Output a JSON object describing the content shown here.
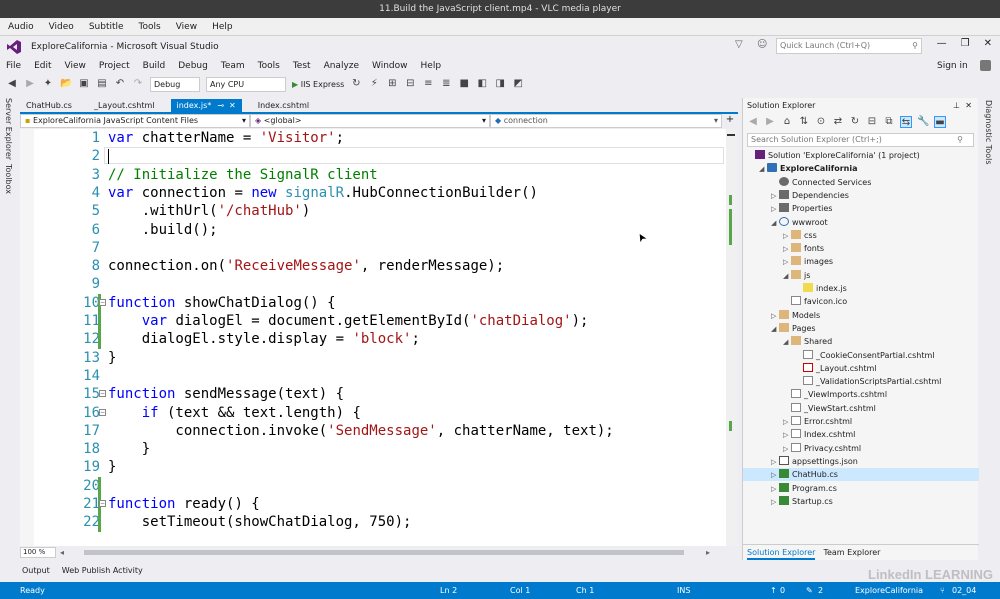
{
  "vlc": {
    "title": "11.Build the JavaScript client.mp4 - VLC media player",
    "menu": [
      "Audio",
      "Video",
      "Subtitle",
      "Tools",
      "View",
      "Help"
    ]
  },
  "vs": {
    "title": "ExploreCalifornia - Microsoft Visual Studio",
    "quick_launch": "Quick Launch (Ctrl+Q)",
    "signin": "Sign in",
    "menu": [
      "File",
      "Edit",
      "View",
      "Project",
      "Build",
      "Debug",
      "Team",
      "Tools",
      "Test",
      "Analyze",
      "Window",
      "Help"
    ],
    "toolbar": {
      "config": "Debug",
      "platform": "Any CPU",
      "run": "IIS Express"
    }
  },
  "side_panels": {
    "left": [
      "Server Explorer",
      "Toolbox"
    ],
    "right": [
      "Diagnostic Tools"
    ]
  },
  "tabs": [
    {
      "label": "ChatHub.cs",
      "active": false
    },
    {
      "label": "_Layout.cshtml",
      "active": false
    },
    {
      "label": "index.js*",
      "active": true
    },
    {
      "label": "Index.cshtml",
      "active": false
    }
  ],
  "nav": {
    "project": "ExploreCalifornia JavaScript Content Files",
    "scope": "<global>",
    "member": "connection"
  },
  "code_lines": [
    {
      "n": "1",
      "html": "<span class='kw'>var</span> chatterName = <span class='str'>'Visitor'</span>;"
    },
    {
      "n": "2",
      "html": ""
    },
    {
      "n": "3",
      "html": "<span class='cmt'>// Initialize the SignalR client</span>"
    },
    {
      "n": "4",
      "html": "<span class='kw'>var</span> connection = <span class='kw'>new</span> <span class='typ'>signalR</span>.HubConnectionBuilder()"
    },
    {
      "n": "5",
      "html": "    .withUrl(<span class='str'>'/chatHub'</span>)"
    },
    {
      "n": "6",
      "html": "    .build();"
    },
    {
      "n": "7",
      "html": ""
    },
    {
      "n": "8",
      "html": "connection.on(<span class='str'>'ReceiveMessage'</span>, renderMessage);"
    },
    {
      "n": "9",
      "html": ""
    },
    {
      "n": "10",
      "html": "<span class='kw'>function</span> showChatDialog() {"
    },
    {
      "n": "11",
      "html": "    <span class='kw'>var</span> dialogEl = document.getElementById(<span class='str'>'chatDialog'</span>);"
    },
    {
      "n": "12",
      "html": "    dialogEl.style.display = <span class='str'>'block'</span>;"
    },
    {
      "n": "13",
      "html": "}"
    },
    {
      "n": "14",
      "html": ""
    },
    {
      "n": "15",
      "html": "<span class='kw'>function</span> sendMessage(text) {"
    },
    {
      "n": "16",
      "html": "    <span class='kw'>if</span> (text &amp;&amp; text.length) {"
    },
    {
      "n": "17",
      "html": "        connection.invoke(<span class='str'>'SendMessage'</span>, chatterName, text);"
    },
    {
      "n": "18",
      "html": "    }"
    },
    {
      "n": "19",
      "html": "}"
    },
    {
      "n": "20",
      "html": ""
    },
    {
      "n": "21",
      "html": "<span class='kw'>function</span> ready() {"
    },
    {
      "n": "22",
      "html": "    setTimeout(showChatDialog, 750);"
    }
  ],
  "zoom": "100 %",
  "bottom_tabs": [
    "Output",
    "Web Publish Activity"
  ],
  "solution_explorer": {
    "title": "Solution Explorer",
    "search": "Search Solution Explorer (Ctrl+;)",
    "items": [
      {
        "label": "Solution 'ExploreCalifornia' (1 project)",
        "indent": 0,
        "arrow": "",
        "icon": "solution"
      },
      {
        "label": "ExploreCalifornia",
        "indent": 1,
        "arrow": "▲",
        "icon": "project",
        "bold": true
      },
      {
        "label": "Connected Services",
        "indent": 2,
        "arrow": "",
        "icon": "services"
      },
      {
        "label": "Dependencies",
        "indent": 2,
        "arrow": "▶",
        "icon": "deps"
      },
      {
        "label": "Properties",
        "indent": 2,
        "arrow": "▶",
        "icon": "wrench"
      },
      {
        "label": "wwwroot",
        "indent": 2,
        "arrow": "▲",
        "icon": "globe"
      },
      {
        "label": "css",
        "indent": 3,
        "arrow": "▶",
        "icon": "folder"
      },
      {
        "label": "fonts",
        "indent": 3,
        "arrow": "▶",
        "icon": "folder"
      },
      {
        "label": "images",
        "indent": 3,
        "arrow": "▶",
        "icon": "folder"
      },
      {
        "label": "js",
        "indent": 3,
        "arrow": "▲",
        "icon": "folder"
      },
      {
        "label": "index.js",
        "indent": 4,
        "arrow": "",
        "icon": "js"
      },
      {
        "label": "favicon.ico",
        "indent": 3,
        "arrow": "",
        "icon": "file"
      },
      {
        "label": "Models",
        "indent": 2,
        "arrow": "▶",
        "icon": "folder"
      },
      {
        "label": "Pages",
        "indent": 2,
        "arrow": "▲",
        "icon": "folder"
      },
      {
        "label": "Shared",
        "indent": 3,
        "arrow": "▲",
        "icon": "folder"
      },
      {
        "label": "_CookieConsentPartial.cshtml",
        "indent": 4,
        "arrow": "",
        "icon": "file"
      },
      {
        "label": "_Layout.cshtml",
        "indent": 4,
        "arrow": "",
        "icon": "fileedit"
      },
      {
        "label": "_ValidationScriptsPartial.cshtml",
        "indent": 4,
        "arrow": "",
        "icon": "file"
      },
      {
        "label": "_ViewImports.cshtml",
        "indent": 3,
        "arrow": "",
        "icon": "file"
      },
      {
        "label": "_ViewStart.cshtml",
        "indent": 3,
        "arrow": "",
        "icon": "file"
      },
      {
        "label": "Error.cshtml",
        "indent": 3,
        "arrow": "▶",
        "icon": "file"
      },
      {
        "label": "Index.cshtml",
        "indent": 3,
        "arrow": "▶",
        "icon": "file"
      },
      {
        "label": "Privacy.cshtml",
        "indent": 3,
        "arrow": "▶",
        "icon": "file"
      },
      {
        "label": "appsettings.json",
        "indent": 2,
        "arrow": "▶",
        "icon": "json"
      },
      {
        "label": "ChatHub.cs",
        "indent": 2,
        "arrow": "▶",
        "icon": "cs",
        "selected": true
      },
      {
        "label": "Program.cs",
        "indent": 2,
        "arrow": "▶",
        "icon": "cs"
      },
      {
        "label": "Startup.cs",
        "indent": 2,
        "arrow": "▶",
        "icon": "cs"
      }
    ],
    "tabs": [
      "Solution Explorer",
      "Team Explorer"
    ]
  },
  "status": {
    "ready": "Ready",
    "ln": "Ln 2",
    "col": "Col 1",
    "ch": "Ch 1",
    "ins": "INS",
    "up": "0",
    "pen": "2",
    "project": "ExploreCalifornia",
    "branch": "02_04"
  },
  "watermark": "LinkedIn LEARNING",
  "colors": {
    "accent": "#007acc",
    "keyword": "#0000ff",
    "string": "#a31515",
    "comment": "#008000",
    "type": "#2b91af"
  }
}
